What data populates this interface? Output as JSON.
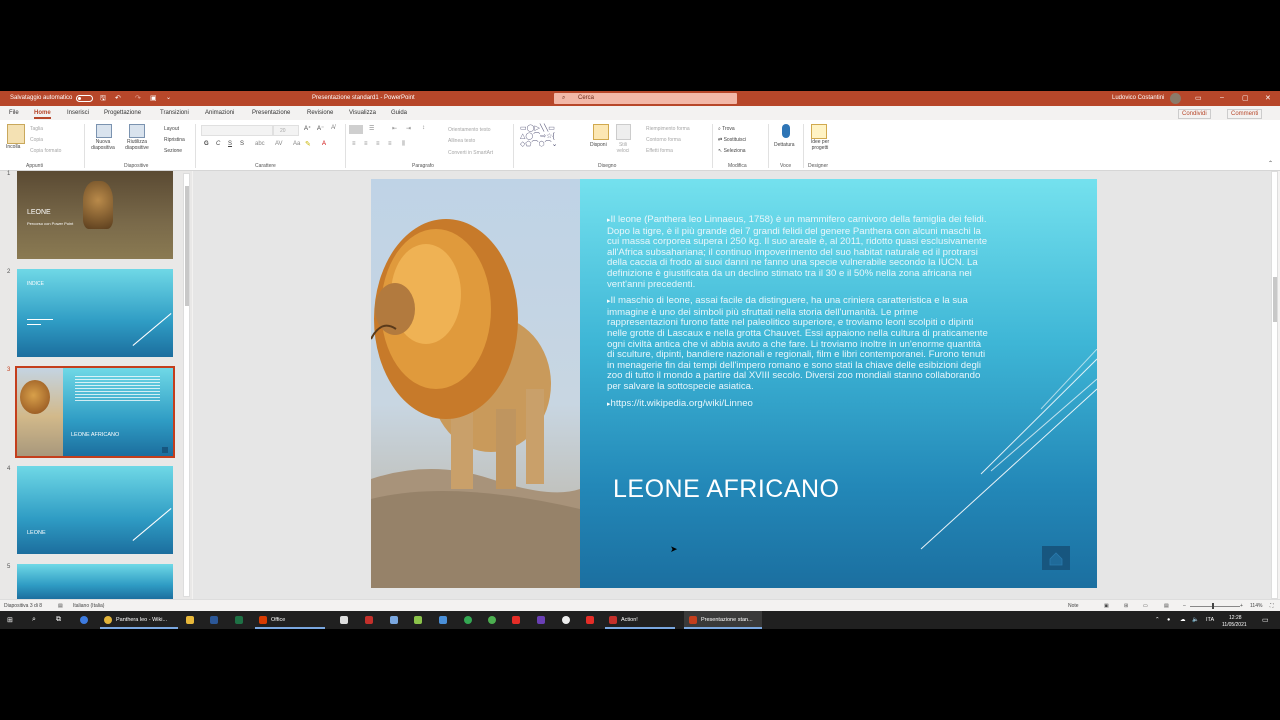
{
  "titlebar": {
    "autosave_label": "Salvataggio automatico",
    "doc_title": "Presentazione standard1 - PowerPoint",
    "search_placeholder": "Cerca",
    "user_name": "Ludovico Costantini"
  },
  "tabs": [
    "File",
    "Home",
    "Inserisci",
    "Progettazione",
    "Transizioni",
    "Animazioni",
    "Presentazione",
    "Revisione",
    "Visualizza",
    "Guida"
  ],
  "active_tab": "Home",
  "share_label": "Condividi",
  "comments_label": "Commenti",
  "ribbon": {
    "appunti": {
      "paste": "Incolla",
      "cut": "Taglia",
      "copy": "Copia",
      "format_painter": "Copia formato",
      "group": "Appunti"
    },
    "diapositive": {
      "new_slide": "Nuova diapositiva",
      "reuse": "Riutilizza diapositive",
      "layout": "Layout",
      "reset": "Ripristina",
      "section": "Sezione",
      "group": "Diapositive"
    },
    "carattere": {
      "font_size": "20",
      "bold": "G",
      "italic": "C",
      "underline": "S",
      "strike": "S",
      "group": "Carattere"
    },
    "paragrafo": {
      "text_direction": "Orientamento testo",
      "align_text": "Allinea testo",
      "smartart": "Converti in SmartArt",
      "group": "Paragrafo"
    },
    "disegno": {
      "arrange": "Disponi",
      "quick_styles": "Stili veloci",
      "fill": "Riempimento forma",
      "outline": "Contorno forma",
      "effects": "Effetti forma",
      "group": "Disegno"
    },
    "modifica": {
      "find": "Trova",
      "replace": "Sostituisci",
      "select": "Seleziona",
      "group": "Modifica"
    },
    "voce": {
      "dictate": "Dettatura",
      "group": "Voce"
    },
    "designer": {
      "ideas": "Idee per progetti",
      "group": "Designer"
    }
  },
  "thumbnails": [
    {
      "num": "1",
      "title": "LEONE",
      "subtitle": "Percorso con Power Point"
    },
    {
      "num": "2",
      "title": "INDICE"
    },
    {
      "num": "3",
      "title": "LEONE AFRICANO"
    },
    {
      "num": "4",
      "title": "LEONE"
    },
    {
      "num": "5"
    }
  ],
  "slide": {
    "paragraphs": [
      "Il leone (Panthera leo Linnaeus, 1758) è un mammifero carnivoro della famiglia dei felidi. Dopo la tigre, è il più grande dei 7 grandi felidi del genere Panthera con alcuni maschi la cui massa corporea supera i 250 kg. Il suo areale è, al 2011, ridotto quasi esclusivamente all'Africa subsahariana; il continuo impoverimento del suo habitat naturale ed il protrarsi della caccia di frodo ai suoi danni ne fanno una specie vulnerabile secondo la IUCN. La definizione è giustificata da un declino stimato tra il 30 e il 50% nella zona africana nei vent'anni precedenti.",
      "Il maschio di leone, assai facile da distinguere, ha una criniera caratteristica e la sua immagine è uno dei simboli più sfruttati nella storia dell'umanità. Le prime rappresentazioni furono fatte nel paleolitico superiore, e troviamo leoni scolpiti o dipinti nelle grotte di Lascaux e nella grotta Chauvet. Essi appaiono nella cultura di praticamente ogni civiltà antica che vi abbia avuto a che fare. Li troviamo inoltre in un'enorme quantità di sculture, dipinti, bandiere nazionali e regionali, film e libri contemporanei. Furono tenuti in menagerie fin dai tempi dell'impero romano e sono stati la chiave delle esibizioni degli zoo di tutto il mondo a partire dal XVIII secolo. Diversi zoo mondiali stanno collaborando per salvare la sottospecie asiatica.",
      "https://it.wikipedia.org/wiki/Linneo"
    ],
    "title": "LEONE AFRICANO"
  },
  "status": {
    "slide_count": "Diapositiva 3 di 8",
    "language": "Italiano (Italia)",
    "notes": "Note",
    "zoom": "114%"
  },
  "taskbar": {
    "chrome_label": "Panthera leo - Wiki...",
    "office_label": "Office",
    "action_label": "Action!",
    "ppt_label": "Presentazione stan...",
    "lang": "ITA",
    "time": "12:28",
    "date": "11/05/2021"
  }
}
